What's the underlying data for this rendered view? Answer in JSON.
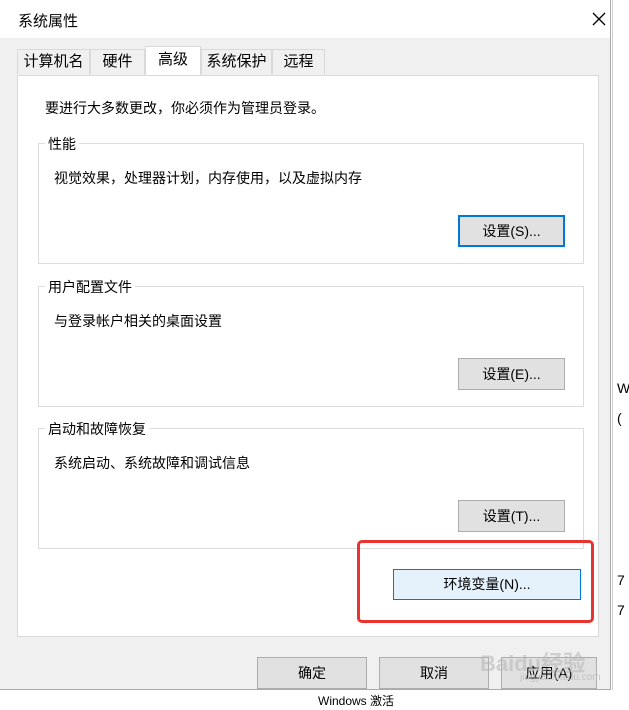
{
  "window": {
    "title": "系统属性"
  },
  "tabs": [
    {
      "label": "计算机名"
    },
    {
      "label": "硬件"
    },
    {
      "label": "高级"
    },
    {
      "label": "系统保护"
    },
    {
      "label": "远程"
    }
  ],
  "notice": "要进行大多数更改，你必须作为管理员登录。",
  "groups": [
    {
      "title": "性能",
      "description": "视觉效果，处理器计划，内存使用，以及虚拟内存",
      "button": "设置(S)..."
    },
    {
      "title": "用户配置文件",
      "description": "与登录帐户相关的桌面设置",
      "button": "设置(E)..."
    },
    {
      "title": "启动和故障恢复",
      "description": "系统启动、系统故障和调试信息",
      "button": "设置(T)..."
    }
  ],
  "env_button": "环境变量(N)...",
  "footer": {
    "ok": "确定",
    "cancel": "取消",
    "apply": "应用(A)"
  },
  "background": {
    "frag1": "(",
    "frag2": "W",
    "frag3": "7",
    "frag4": "7",
    "frag5": "Windows 激活"
  },
  "watermark": {
    "main": "Baidu经验",
    "sub": "jingyan.baidu.com"
  },
  "colors": {
    "highlight": "#e8342f",
    "focus": "#0078d7"
  }
}
